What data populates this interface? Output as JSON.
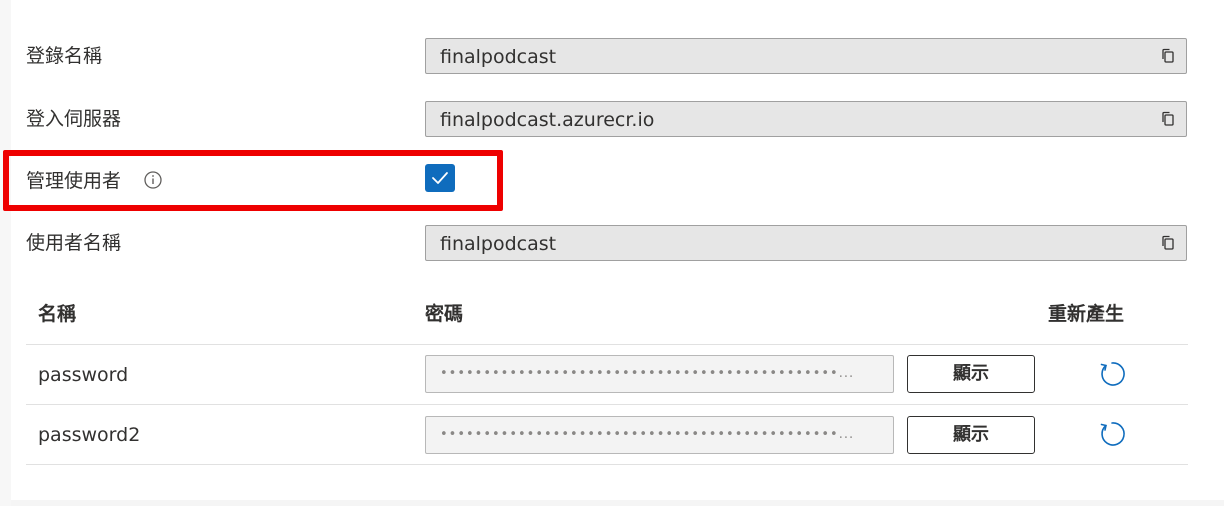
{
  "form": {
    "registry_name": {
      "label": "登錄名稱",
      "value": "finalpodcast"
    },
    "login_server": {
      "label": "登入伺服器",
      "value": "finalpodcast.azurecr.io"
    },
    "admin_user": {
      "label": "管理使用者",
      "checked": true
    },
    "username": {
      "label": "使用者名稱",
      "value": "finalpodcast"
    }
  },
  "passwords_table": {
    "headers": {
      "name": "名稱",
      "password": "密碼",
      "regenerate": "重新產生"
    },
    "rows": [
      {
        "name": "password",
        "masked_value": "••••••••••••••••••••••••••••••••••••••••••••••...",
        "show_label": "顯示"
      },
      {
        "name": "password2",
        "masked_value": "••••••••••••••••••••••••••••••••••••••••••••••...",
        "show_label": "顯示"
      }
    ]
  },
  "icons": {
    "copy": "copy-icon",
    "info": "info-icon",
    "checkmark": "checkmark-icon",
    "regenerate": "refresh-icon"
  },
  "colors": {
    "accent": "#0f6cbd",
    "highlight": "#ee0000",
    "field_background": "#e6e6e6"
  }
}
